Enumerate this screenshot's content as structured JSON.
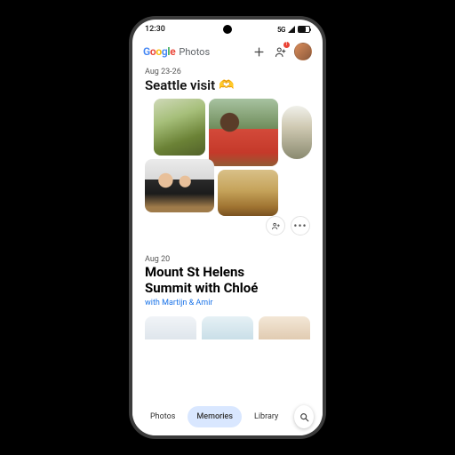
{
  "statusbar": {
    "time": "12:30",
    "network_label": "5G"
  },
  "appbar": {
    "logo_word": "Google",
    "logo_sub": "Photos",
    "badge_count": "1"
  },
  "memory1": {
    "date_range": "Aug 23-26",
    "title": "Seattle visit",
    "emoji": "🫶"
  },
  "memory2": {
    "date": "Aug 20",
    "title_line1": "Mount St Helens",
    "title_line2": "Summit with Chloé",
    "subtitle": "with Martijn & Amir"
  },
  "navbar": {
    "photos": "Photos",
    "memories": "Memories",
    "library": "Library"
  }
}
